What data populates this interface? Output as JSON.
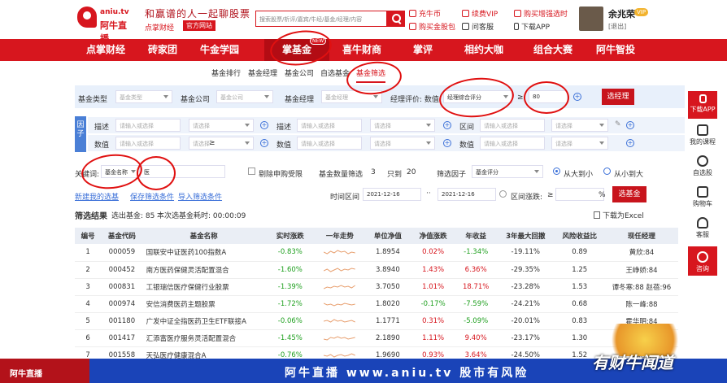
{
  "header": {
    "logo_domain": "aniu.tv",
    "logo_name": "阿牛直播",
    "slogan": "和赢谱的人一起聊股票",
    "sub_brand": "点掌财经",
    "official_tag": "官方网站",
    "search_placeholder": "搜索股票/析评/嘉宾/牛经/基金/经理/内容",
    "links": {
      "recharge": "充牛币",
      "renew_vip": "续费VIP",
      "buy_stock_pick": "购买增强选时",
      "buy_red_packet": "购买金股包",
      "customer_service": "问客服",
      "download_app": "下载APP"
    },
    "user": {
      "name": "余兆荣",
      "vip": "VIP",
      "logout": "[退出]"
    }
  },
  "nav": {
    "items": [
      "点掌财经",
      "砖家团",
      "牛金学园",
      "掌基金",
      "喜牛财商",
      "掌评",
      "相约大咖",
      "组合大赛",
      "阿牛智投"
    ],
    "active_index": 3,
    "new_badge": "NEW"
  },
  "subnav": {
    "items": [
      "基金排行",
      "基金经理",
      "基金公司",
      "自选基金",
      "基金筛选"
    ],
    "active_index": 4
  },
  "filters": {
    "fund_type_label": "基金类型",
    "fund_type_placeholder": "基金类型",
    "fund_company_label": "基金公司",
    "fund_company_placeholder": "基金公司",
    "fund_manager_label": "基金经理",
    "fund_manager_placeholder": "基金经理",
    "manager_rating_label": "经理评价: 数值",
    "manager_rating_value": "经理综合评分",
    "rating_op": "≥",
    "rating_value": "80",
    "select_manager_btn": "选经理",
    "factor_tag": "因子",
    "desc_label": "描述",
    "num_label": "数值",
    "interval_label": "区间",
    "input_placeholder": "请输入或选择",
    "select_placeholder": "请选择",
    "ge": "≥",
    "keyword_label": "关键词:",
    "keyword_type": "基金名称",
    "keyword_value": "医",
    "exclude_label": "剔除申购受限",
    "count_filter_label": "基金数量筛选",
    "count_filter_value": "3",
    "count_only": "只到",
    "count_to": "20",
    "select_factor_label": "筛选因子",
    "select_factor_value": "基金评分",
    "sort_asc": "从大到小",
    "sort_desc": "从小到大",
    "link_new_pick": "新建我的选基",
    "link_save": "保存筛选条件",
    "link_import": "导入筛选条件",
    "time_label": "时间区间",
    "date_from": "2021-12-16",
    "date_to": "2021-12-16",
    "range_change": "区间涨跌:",
    "range_change_op": "≥",
    "pct": "%",
    "select_fund_btn": "选基金"
  },
  "results": {
    "title": "筛选结果",
    "count_text": "选出基金: 85",
    "time_text": "本次选基金耗时: 00:00:09",
    "download": "下载为Excel"
  },
  "table": {
    "headers": [
      "编号",
      "基金代码",
      "基金名称",
      "实时涨跌",
      "一年走势",
      "单位净值",
      "净值涨跌",
      "年收益",
      "3年最大回撤",
      "风险收益比",
      "现任经理"
    ],
    "rows": [
      {
        "no": "1",
        "code": "000059",
        "name": "国联安中证医药100指数A",
        "rt": "-0.83%",
        "nav": "1.8954",
        "chg": "0.02%",
        "yr": "-1.34%",
        "dd": "-19.11%",
        "rr": "0.89",
        "mgr": "黄欣:84",
        "rt_c": "green",
        "chg_c": "red",
        "yr_c": "green"
      },
      {
        "no": "2",
        "code": "000452",
        "name": "南方医药保健灵活配置混合",
        "rt": "-1.60%",
        "nav": "3.8940",
        "chg": "1.43%",
        "yr": "6.36%",
        "dd": "-29.35%",
        "rr": "1.25",
        "mgr": "王峥娇:84",
        "rt_c": "green",
        "chg_c": "red",
        "yr_c": "red"
      },
      {
        "no": "3",
        "code": "000831",
        "name": "工银瑞信医疗保健行业股票",
        "rt": "-1.39%",
        "nav": "3.7050",
        "chg": "1.01%",
        "yr": "18.71%",
        "dd": "-23.28%",
        "rr": "1.53",
        "mgr": "谭冬寒:88 赵蓓:96",
        "rt_c": "green",
        "chg_c": "red",
        "yr_c": "red"
      },
      {
        "no": "4",
        "code": "000974",
        "name": "安信消费医药主题股票",
        "rt": "-1.72%",
        "nav": "1.8020",
        "chg": "-0.17%",
        "yr": "-7.59%",
        "dd": "-24.21%",
        "rr": "0.68",
        "mgr": "陈一峰:88",
        "rt_c": "green",
        "chg_c": "green",
        "yr_c": "green"
      },
      {
        "no": "5",
        "code": "001180",
        "name": "广发中证全指医药卫生ETF联接A",
        "rt": "-0.06%",
        "nav": "1.1771",
        "chg": "0.31%",
        "yr": "-5.09%",
        "dd": "-20.01%",
        "rr": "0.83",
        "mgr": "霍华明:84",
        "rt_c": "green",
        "chg_c": "red",
        "yr_c": "green"
      },
      {
        "no": "6",
        "code": "001417",
        "name": "汇添富医疗服务灵活配置混合",
        "rt": "-1.45%",
        "nav": "2.1890",
        "chg": "1.11%",
        "yr": "9.40%",
        "dd": "-23.17%",
        "rr": "1.30",
        "mgr": "刘",
        "rt_c": "green",
        "chg_c": "red",
        "yr_c": "red"
      },
      {
        "no": "7",
        "code": "001558",
        "name": "天弘医疗健康混合A",
        "rt": "-0.76%",
        "nav": "1.9690",
        "chg": "0.93%",
        "yr": "3.64%",
        "dd": "-24.50%",
        "rr": "1.52",
        "mgr": "郭相博",
        "rt_c": "green",
        "chg_c": "red",
        "yr_c": "red"
      }
    ]
  },
  "sidebar": {
    "download_app": "下载APP",
    "my_course": "我的课程",
    "my_stocks": "自选股",
    "cart": "购物车",
    "service": "客服",
    "consult": "咨询"
  },
  "banner": {
    "logo": "阿牛直播",
    "text": "阿牛直播 www.aniu.tv 股市有风险",
    "right": "有财牛闻道"
  }
}
